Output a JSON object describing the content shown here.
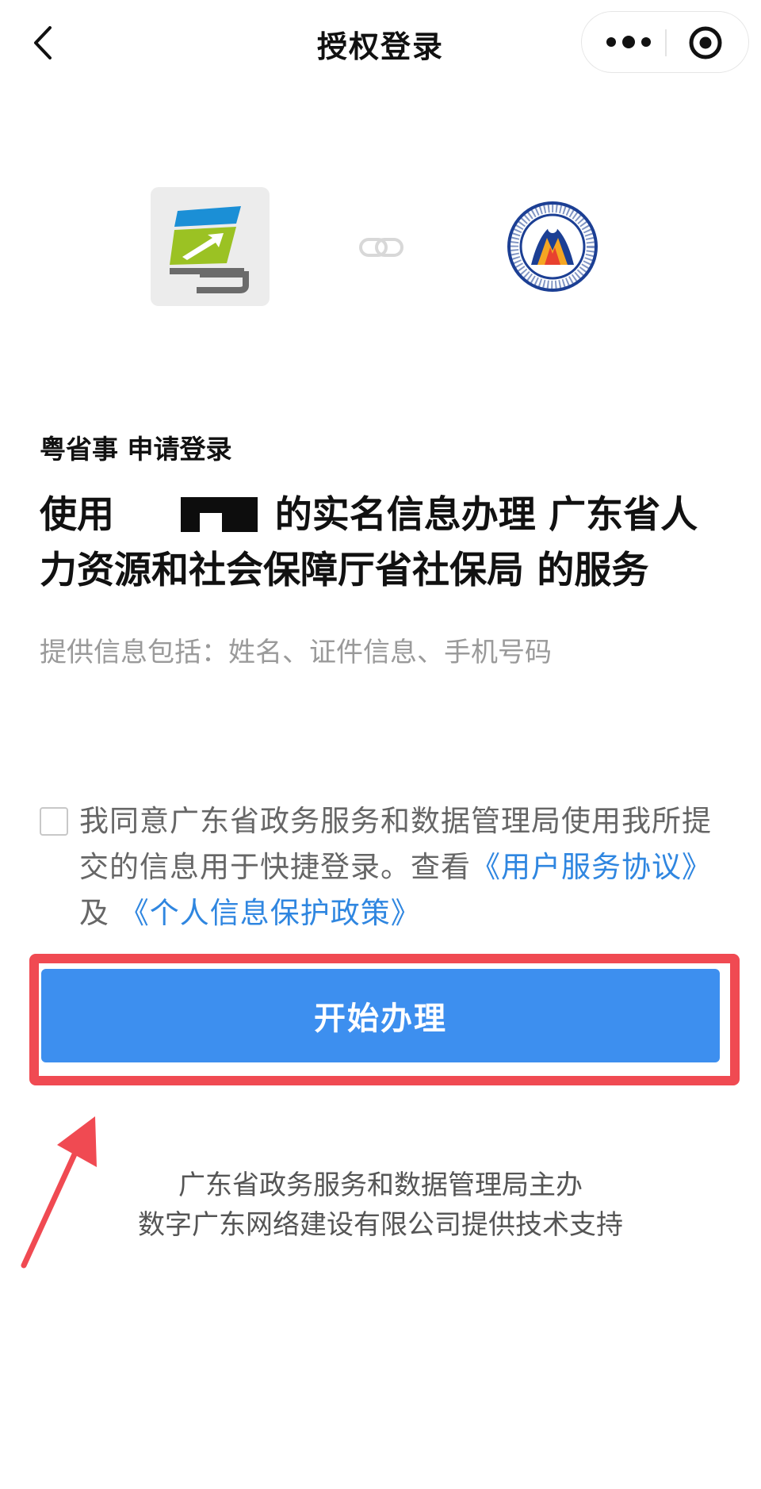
{
  "nav": {
    "title": "授权登录",
    "icons": {
      "back": "chevron-left-icon",
      "more": "more-dots-icon",
      "close": "target-close-icon"
    }
  },
  "logos": {
    "app_icon": "yueshengshi-app-logo",
    "link_icon": "link-icon",
    "dept_icon": "guangdong-hr-social-security-dept-seal",
    "dept_seal_text": "广东省人力资源和社会保障厅"
  },
  "request": {
    "requester": "粤省事 申请登录",
    "headline_prefix": "使用",
    "headline_suffix": "的实名信息办理 广东省人力资源和社会保障厅省社保局 的服务",
    "info": "提供信息包括：姓名、证件信息、手机号码"
  },
  "agreement": {
    "checked": false,
    "text": "我同意广东省政务服务和数据管理局使用我所提交的信息用于快捷登录。查看",
    "user_agreement_link": "《用户服务协议》",
    "conjunction": "及",
    "privacy_link": "《个人信息保护政策》"
  },
  "actions": {
    "start_label": "开始办理"
  },
  "footer": {
    "line1": "广东省政务服务和数据管理局主办",
    "line2": "数字广东网络建设有限公司提供技术支持"
  },
  "colors": {
    "primary_button": "#3d8fef",
    "link": "#2f86e0",
    "highlight_annotation": "#f04a52",
    "secondary_text": "#9a9a9a"
  }
}
